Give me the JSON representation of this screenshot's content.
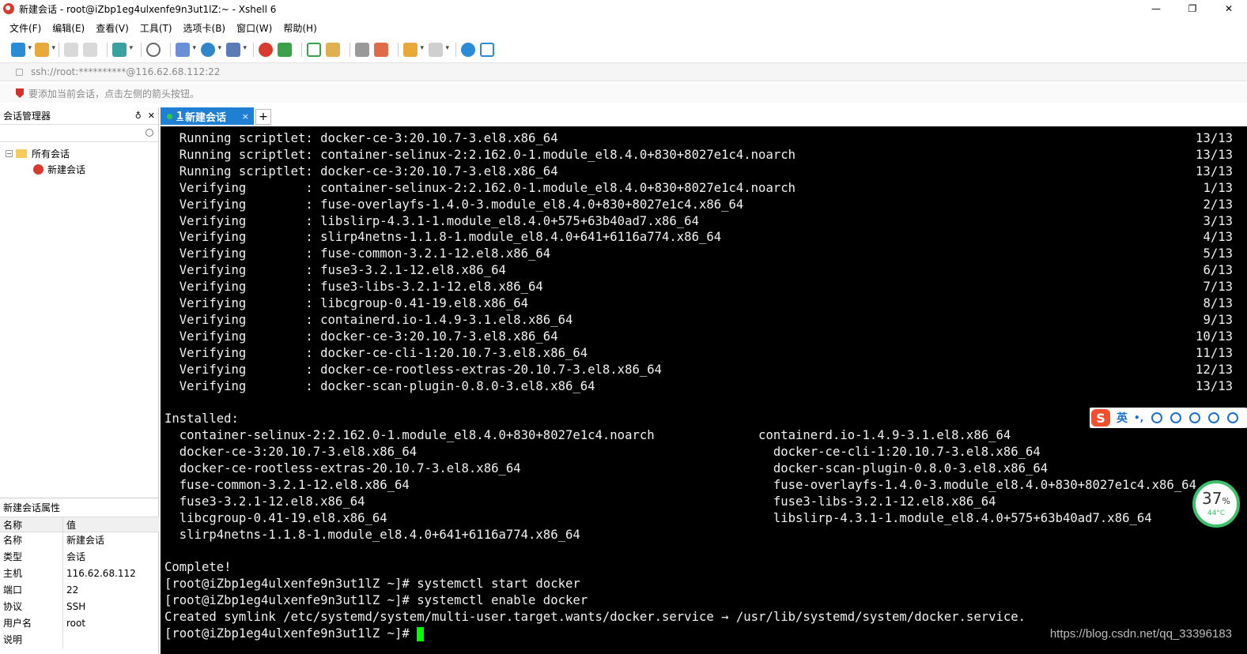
{
  "window": {
    "title": "新建会话 - root@iZbp1eg4ulxenfe9n3ut1lZ:~ - Xshell 6",
    "minimize": "—",
    "restore": "❐",
    "close": "✕"
  },
  "menu": [
    "文件(F)",
    "编辑(E)",
    "查看(V)",
    "工具(T)",
    "选项卡(B)",
    "窗口(W)",
    "帮助(H)"
  ],
  "toolbar_icons": [
    "new-session-icon",
    "open-folder-icon",
    "reconnect-icon",
    "disconnect-icon",
    "new-tab-icon",
    "find-icon",
    "transfer-icon",
    "globe-icon",
    "font-icon",
    "xftp-icon",
    "sftp-icon",
    "fullscreen-icon",
    "lock-icon",
    "keyboard-icon",
    "highlight-icon",
    "compose-icon",
    "layout-icon",
    "help-icon",
    "chat-icon"
  ],
  "address": {
    "text": "ssh://root:**********@116.62.68.112:22"
  },
  "hint": {
    "text": "要添加当前会话，点击左侧的箭头按钮。"
  },
  "session_manager": {
    "title": "会话管理器",
    "pin": "♁",
    "close": "✕",
    "tree": {
      "root_expander": "−",
      "root_label": "所有会话",
      "child_label": "新建会话"
    }
  },
  "properties": {
    "title": "新建会话属性",
    "col_name": "名称",
    "col_value": "值",
    "rows": [
      {
        "name": "名称",
        "value": "新建会话"
      },
      {
        "name": "类型",
        "value": "会话"
      },
      {
        "name": "主机",
        "value": "116.62.68.112"
      },
      {
        "name": "端口",
        "value": "22"
      },
      {
        "name": "协议",
        "value": "SSH"
      },
      {
        "name": "用户名",
        "value": "root"
      },
      {
        "name": "说明",
        "value": ""
      }
    ]
  },
  "tabs": [
    {
      "num": "1",
      "label": "新建会话",
      "close": "×"
    }
  ],
  "new_tab": "+",
  "terminal": {
    "lines": [
      {
        "left": "  Running scriptlet: docker-ce-3:20.10.7-3.el8.x86_64",
        "right": "13/13"
      },
      {
        "left": "  Running scriptlet: container-selinux-2:2.162.0-1.module_el8.4.0+830+8027e1c4.noarch",
        "right": "13/13"
      },
      {
        "left": "  Running scriptlet: docker-ce-3:20.10.7-3.el8.x86_64",
        "right": "13/13"
      },
      {
        "left": "  Verifying        : container-selinux-2:2.162.0-1.module_el8.4.0+830+8027e1c4.noarch",
        "right": "1/13"
      },
      {
        "left": "  Verifying        : fuse-overlayfs-1.4.0-3.module_el8.4.0+830+8027e1c4.x86_64",
        "right": "2/13"
      },
      {
        "left": "  Verifying        : libslirp-4.3.1-1.module_el8.4.0+575+63b40ad7.x86_64",
        "right": "3/13"
      },
      {
        "left": "  Verifying        : slirp4netns-1.1.8-1.module_el8.4.0+641+6116a774.x86_64",
        "right": "4/13"
      },
      {
        "left": "  Verifying        : fuse-common-3.2.1-12.el8.x86_64",
        "right": "5/13"
      },
      {
        "left": "  Verifying        : fuse3-3.2.1-12.el8.x86_64",
        "right": "6/13"
      },
      {
        "left": "  Verifying        : fuse3-libs-3.2.1-12.el8.x86_64",
        "right": "7/13"
      },
      {
        "left": "  Verifying        : libcgroup-0.41-19.el8.x86_64",
        "right": "8/13"
      },
      {
        "left": "  Verifying        : containerd.io-1.4.9-3.1.el8.x86_64",
        "right": "9/13"
      },
      {
        "left": "  Verifying        : docker-ce-3:20.10.7-3.el8.x86_64",
        "right": "10/13"
      },
      {
        "left": "  Verifying        : docker-ce-cli-1:20.10.7-3.el8.x86_64",
        "right": "11/13"
      },
      {
        "left": "  Verifying        : docker-ce-rootless-extras-20.10.7-3.el8.x86_64",
        "right": "12/13"
      },
      {
        "left": "  Verifying        : docker-scan-plugin-0.8.0-3.el8.x86_64",
        "right": "13/13"
      },
      {
        "left": "",
        "right": ""
      },
      {
        "left": "Installed:",
        "right": ""
      },
      {
        "left": "  container-selinux-2:2.162.0-1.module_el8.4.0+830+8027e1c4.noarch              containerd.io-1.4.9-3.1.el8.x86_64",
        "right": ""
      },
      {
        "left": "  docker-ce-3:20.10.7-3.el8.x86_64                                                docker-ce-cli-1:20.10.7-3.el8.x86_64",
        "right": ""
      },
      {
        "left": "  docker-ce-rootless-extras-20.10.7-3.el8.x86_64                                  docker-scan-plugin-0.8.0-3.el8.x86_64",
        "right": ""
      },
      {
        "left": "  fuse-common-3.2.1-12.el8.x86_64                                                 fuse-overlayfs-1.4.0-3.module_el8.4.0+830+8027e1c4.x86_64",
        "right": ""
      },
      {
        "left": "  fuse3-3.2.1-12.el8.x86_64                                                       fuse3-libs-3.2.1-12.el8.x86_64",
        "right": ""
      },
      {
        "left": "  libcgroup-0.41-19.el8.x86_64                                                    libslirp-4.3.1-1.module_el8.4.0+575+63b40ad7.x86_64",
        "right": ""
      },
      {
        "left": "  slirp4netns-1.1.8-1.module_el8.4.0+641+6116a774.x86_64",
        "right": ""
      },
      {
        "left": "",
        "right": ""
      },
      {
        "left": "Complete!",
        "right": ""
      },
      {
        "left": "[root@iZbp1eg4ulxenfe9n3ut1lZ ~]# systemctl start docker",
        "right": ""
      },
      {
        "left": "[root@iZbp1eg4ulxenfe9n3ut1lZ ~]# systemctl enable docker",
        "right": ""
      },
      {
        "left": "Created symlink /etc/systemd/system/multi-user.target.wants/docker.service → /usr/lib/systemd/system/docker.service.",
        "right": ""
      }
    ],
    "prompt": "[root@iZbp1eg4ulxenfe9n3ut1lZ ~]# "
  },
  "ime": {
    "logo": "S",
    "mode": "英",
    "punct": "•,"
  },
  "cpu_widget": {
    "percent": "37",
    "unit": "%",
    "temp": "44°C"
  },
  "watermark": "https://blog.csdn.net/qq_33396183",
  "colors": {
    "accent": "#1e7fd3",
    "terminal_bg": "#000000",
    "cursor": "#00ff00"
  }
}
